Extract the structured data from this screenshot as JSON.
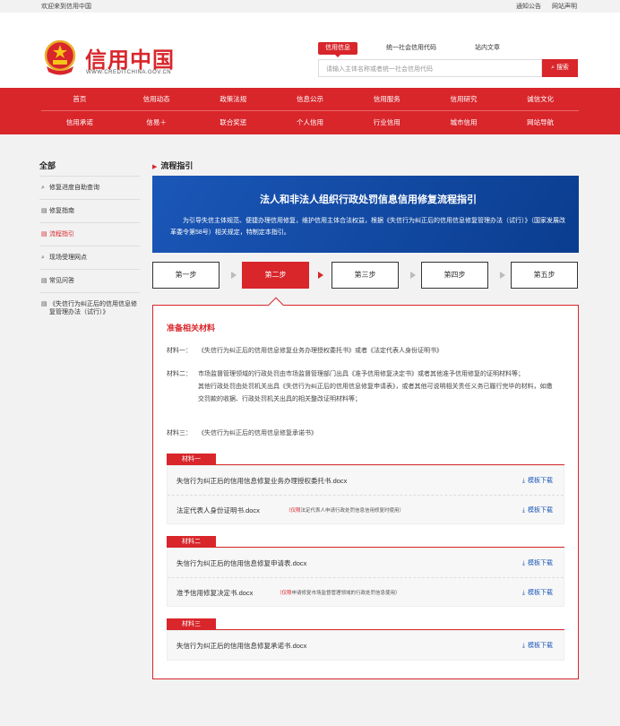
{
  "topbar": {
    "welcome": "欢迎来到信用中国",
    "links": [
      "通知公告",
      "网站声明"
    ]
  },
  "header": {
    "site_name": "信用中国",
    "site_url": "WWW.CREDITCHINA.GOV.CN",
    "search_tabs": [
      "信用信息",
      "统一社会信用代码",
      "站内文章"
    ],
    "search_placeholder": "请输入主体名称或者统一社会信用代码",
    "search_button": "搜索"
  },
  "nav": {
    "row1": [
      "首页",
      "信用动态",
      "政策法规",
      "信息公示",
      "信用服务",
      "信用研究",
      "诚信文化"
    ],
    "row2": [
      "信用承诺",
      "信易＋",
      "联合奖惩",
      "个人信用",
      "行业信用",
      "城市信用",
      "网站导航"
    ]
  },
  "sidebar": {
    "title": "全部",
    "items": [
      {
        "icon": "search-icon",
        "label": "修复进度自助查询"
      },
      {
        "icon": "document-icon",
        "label": "修复指南"
      },
      {
        "icon": "document-icon",
        "label": "流程指引",
        "active": true
      },
      {
        "icon": "search-icon",
        "label": "现场受理网点"
      },
      {
        "icon": "document-icon",
        "label": "常见问答"
      },
      {
        "icon": "document-icon",
        "label": "《失信行为纠正后的信用信息修复管理办法（试行）》"
      }
    ]
  },
  "main": {
    "breadcrumb": "流程指引",
    "banner_title": "法人和非法人组织行政处罚信息信用修复流程指引",
    "banner_text": "为引导失信主体规范、便捷办理信用修复，维护信用主体合法权益，根据《失信行为纠正后的信用信息修复管理办法（试行）》（国家发展改革委令第58号）相关规定，特制定本指引。",
    "steps": [
      "第一步",
      "第二步",
      "第三步",
      "第四步",
      "第五步"
    ],
    "active_step": 1,
    "section_title": "准备相关材料",
    "materials": [
      {
        "label": "材料一：",
        "lines": [
          "《失信行为纠正后的信用信息修复业务办理授权委托书》或者《法定代表人身份证明书》"
        ]
      },
      {
        "label": "材料二：",
        "lines": [
          "市场监督管理领域的行政处罚由市场监督管理部门出具《准予信用修复决定书》或者其他准予信用修复的证明材料等；",
          "其他行政处罚由处罚机关出具《失信行为纠正后的信用信息修复申请表》，或者其他可说明相关责任义务已履行完毕的材料，如缴交罚款的收据、行政处罚机关出具的相关整改证明材料等；"
        ]
      },
      {
        "label": "材料三：",
        "lines": [
          "《失信行为纠正后的信用信息修复承诺书》"
        ]
      }
    ],
    "file_groups": [
      {
        "tag": "材料一",
        "files": [
          {
            "name": "失信行为纠正后的信用信息修复业务办理授权委托书.docx",
            "note_prefix": "",
            "note": ""
          },
          {
            "name": "法定代表人身份证明书.docx",
            "note_prefix": "（仅限",
            "note": "法定代表人申请行政处罚信息信用修复时使用）"
          }
        ]
      },
      {
        "tag": "材料二",
        "files": [
          {
            "name": "失信行为纠正后的信用信息修复申请表.docx",
            "note_prefix": "",
            "note": ""
          },
          {
            "name": "准予信用修复决定书.docx",
            "note_prefix": "（仅限",
            "note": "申请修复市场监督管理领域的行政处罚信息使用）"
          }
        ]
      },
      {
        "tag": "材料三",
        "files": [
          {
            "name": "失信行为纠正后的信用信息修复承诺书.docx",
            "note_prefix": "",
            "note": ""
          }
        ]
      }
    ],
    "download_label": "模板下载"
  },
  "colors": {
    "brand_red": "#d8262b",
    "banner_blue": "#1b57b8",
    "link_blue": "#1b57b8"
  }
}
